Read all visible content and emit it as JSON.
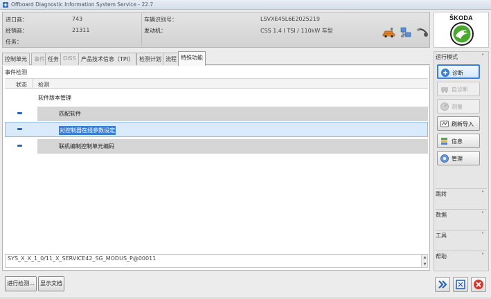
{
  "window": {
    "title": "Offboard Diagnostic Information System Service - 22.7"
  },
  "header": {
    "left": [
      {
        "label": "进口商：",
        "value": "743"
      },
      {
        "label": "经销商：",
        "value": "21311"
      },
      {
        "label": "任务：",
        "value": ""
      }
    ],
    "right": [
      {
        "label": "车辆识别号：",
        "value": "LSVXE45L6E2025219"
      },
      {
        "label": "发动机：",
        "value": "CSS 1.4 l TSI / 110kW 车型"
      }
    ],
    "icons": [
      "car-connect-icon",
      "network-icon",
      "probe-icon"
    ]
  },
  "brand": {
    "name": "ŠKODA",
    "logo_color": "#4ba82e"
  },
  "tabs": [
    {
      "label": "控制单元",
      "state": "normal"
    },
    {
      "label": "事件",
      "state": "dim"
    },
    {
      "label": "任务",
      "state": "normal"
    },
    {
      "label": "DISS",
      "state": "dim"
    },
    {
      "label": "产品技术信息（TPI）",
      "state": "normal"
    },
    {
      "label": "检测计划",
      "state": "normal"
    },
    {
      "label": "流程",
      "state": "normal"
    },
    {
      "label": "特殊功能",
      "state": "active"
    }
  ],
  "main": {
    "section_title": "事件检测",
    "columns": {
      "status": "状态",
      "test": "检测"
    },
    "rows": [
      {
        "text": "软件版本管理",
        "status": false,
        "banded": false,
        "selected": false
      },
      {
        "text": "匹配软件",
        "status": true,
        "banded": true,
        "selected": false
      },
      {
        "text": "对控制器在线参数设定",
        "status": true,
        "banded": false,
        "selected": true
      },
      {
        "text": "联机编制控制单元编码",
        "status": true,
        "banded": true,
        "selected": false
      }
    ],
    "info_text": "SYS_X_X_1_0/11_X_SERVICE42_SG_MODUS_P@00011"
  },
  "bottom_buttons": {
    "run_test": "进行检测...",
    "show_docs": "显示文档"
  },
  "side_panel": {
    "mode_label": "运行模式",
    "buttons": [
      {
        "label": "诊断",
        "icon": "stethoscope-icon",
        "state": "active"
      },
      {
        "label": "自诊断",
        "icon": "car-diagnosis-icon",
        "state": "disabled"
      },
      {
        "label": "测量",
        "icon": "meter-icon",
        "state": "disabled"
      },
      {
        "label": "刷新导入",
        "icon": "flash-icon",
        "state": "normal"
      },
      {
        "label": "信息",
        "icon": "info-stack-icon",
        "state": "normal"
      },
      {
        "label": "管理",
        "icon": "admin-icon",
        "state": "normal"
      }
    ],
    "sections": [
      {
        "label": "跳转"
      },
      {
        "label": "数据"
      },
      {
        "label": "工具"
      },
      {
        "label": "帮助"
      }
    ]
  },
  "colors": {
    "accent_blue": "#3a7fd4",
    "band_gray": "#d5d5d5",
    "selected_bg": "#d9ebfb",
    "status_blue": "#2864c8",
    "close_red": "#d23b2f"
  }
}
